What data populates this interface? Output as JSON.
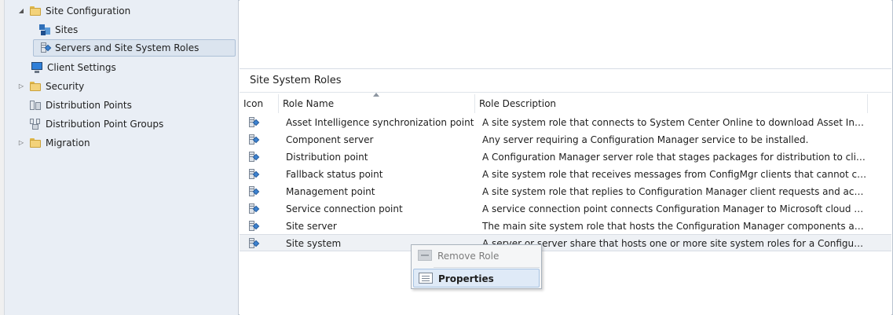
{
  "nav": {
    "items": [
      {
        "label": "Site Configuration",
        "icon": "folder-icon",
        "expander": "expanded"
      },
      {
        "label": "Sites",
        "icon": "sites-icon"
      },
      {
        "label": "Servers and Site System Roles",
        "icon": "site-system-role-icon",
        "selected": true
      },
      {
        "label": "Client Settings",
        "icon": "monitor-icon"
      },
      {
        "label": "Security",
        "icon": "folder-icon",
        "expander": "collapsed"
      },
      {
        "label": "Distribution Points",
        "icon": "distribution-point-icon"
      },
      {
        "label": "Distribution Point Groups",
        "icon": "distribution-point-group-icon"
      },
      {
        "label": "Migration",
        "icon": "folder-icon",
        "expander": "collapsed"
      }
    ]
  },
  "main": {
    "section_title": "Site System Roles",
    "columns": {
      "icon": "Icon",
      "name": "Role Name",
      "description": "Role Description"
    },
    "rows": [
      {
        "name": "Asset Intelligence synchronization point",
        "description": "A site system role that connects to System Center Online to download Asset Intelligence c..."
      },
      {
        "name": "Component server",
        "description": "Any server requiring a Configuration Manager service to be installed."
      },
      {
        "name": "Distribution point",
        "description": "A Configuration Manager server role that stages packages for distribution to clients."
      },
      {
        "name": "Fallback status point",
        "description": "A site system role that receives messages from ConfigMgr clients that cannot communicat..."
      },
      {
        "name": "Management point",
        "description": "A site system role that replies to Configuration Manager client requests and accepts mana..."
      },
      {
        "name": "Service connection point",
        "description": "A service connection point connects Configuration Manager to Microsoft cloud services, it..."
      },
      {
        "name": "Site server",
        "description": "The main site system role that hosts the Configuration Manager components and services."
      },
      {
        "name": "Site system",
        "description": "A server or server share that hosts one or more site system roles for a Configuration Mana...",
        "selected": true
      }
    ]
  },
  "context_menu": {
    "remove_role": "Remove Role",
    "properties": "Properties"
  }
}
